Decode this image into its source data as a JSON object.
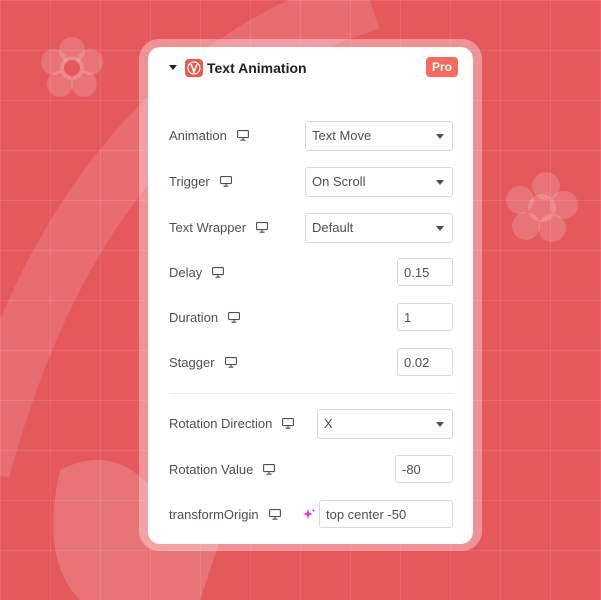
{
  "header": {
    "title": "Text Animation",
    "badge": "Pro"
  },
  "fields": {
    "animation": {
      "label": "Animation",
      "value": "Text Move"
    },
    "trigger": {
      "label": "Trigger",
      "value": "On Scroll"
    },
    "text_wrapper": {
      "label": "Text Wrapper",
      "value": "Default"
    },
    "delay": {
      "label": "Delay",
      "value": "0.15"
    },
    "duration": {
      "label": "Duration",
      "value": "1"
    },
    "stagger": {
      "label": "Stagger",
      "value": "0.02"
    },
    "rotation_direction": {
      "label": "Rotation Direction",
      "value": "X"
    },
    "rotation_value": {
      "label": "Rotation Value",
      "value": "-80"
    },
    "transform_origin": {
      "label": "transformOrigin",
      "value": "top center -50"
    }
  },
  "icons": {
    "responsive": "monitor-icon",
    "dynamic": "sparkle-icon",
    "collapse": "caret-down-icon",
    "logo": "brand-logo-icon"
  },
  "colors": {
    "background": "#e5585c",
    "accent": "#f36c5d",
    "dynamic_icon": "#d63ad6"
  }
}
